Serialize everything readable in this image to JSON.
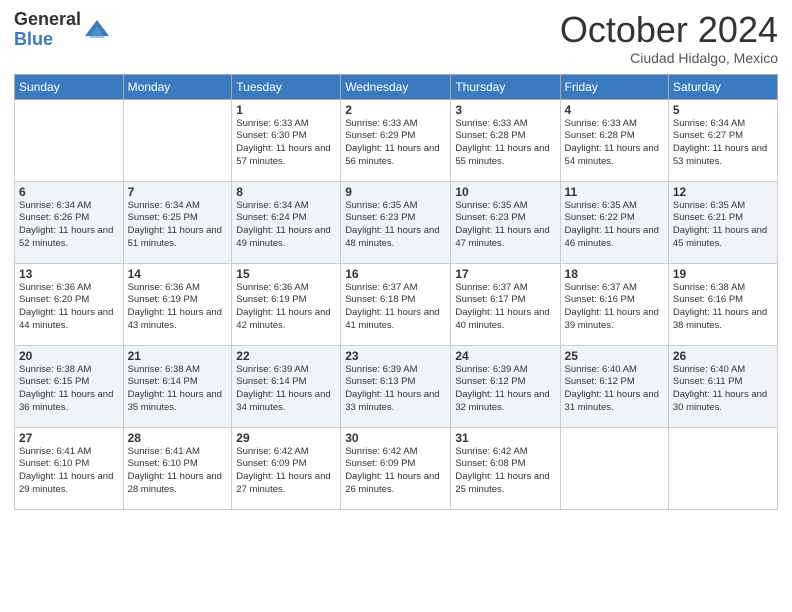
{
  "logo": {
    "general": "General",
    "blue": "Blue"
  },
  "title": "October 2024",
  "location": "Ciudad Hidalgo, Mexico",
  "days_of_week": [
    "Sunday",
    "Monday",
    "Tuesday",
    "Wednesday",
    "Thursday",
    "Friday",
    "Saturday"
  ],
  "weeks": [
    [
      {
        "day": "",
        "info": ""
      },
      {
        "day": "",
        "info": ""
      },
      {
        "day": "1",
        "info": "Sunrise: 6:33 AM\nSunset: 6:30 PM\nDaylight: 11 hours and 57 minutes."
      },
      {
        "day": "2",
        "info": "Sunrise: 6:33 AM\nSunset: 6:29 PM\nDaylight: 11 hours and 56 minutes."
      },
      {
        "day": "3",
        "info": "Sunrise: 6:33 AM\nSunset: 6:28 PM\nDaylight: 11 hours and 55 minutes."
      },
      {
        "day": "4",
        "info": "Sunrise: 6:33 AM\nSunset: 6:28 PM\nDaylight: 11 hours and 54 minutes."
      },
      {
        "day": "5",
        "info": "Sunrise: 6:34 AM\nSunset: 6:27 PM\nDaylight: 11 hours and 53 minutes."
      }
    ],
    [
      {
        "day": "6",
        "info": "Sunrise: 6:34 AM\nSunset: 6:26 PM\nDaylight: 11 hours and 52 minutes."
      },
      {
        "day": "7",
        "info": "Sunrise: 6:34 AM\nSunset: 6:25 PM\nDaylight: 11 hours and 51 minutes."
      },
      {
        "day": "8",
        "info": "Sunrise: 6:34 AM\nSunset: 6:24 PM\nDaylight: 11 hours and 49 minutes."
      },
      {
        "day": "9",
        "info": "Sunrise: 6:35 AM\nSunset: 6:23 PM\nDaylight: 11 hours and 48 minutes."
      },
      {
        "day": "10",
        "info": "Sunrise: 6:35 AM\nSunset: 6:23 PM\nDaylight: 11 hours and 47 minutes."
      },
      {
        "day": "11",
        "info": "Sunrise: 6:35 AM\nSunset: 6:22 PM\nDaylight: 11 hours and 46 minutes."
      },
      {
        "day": "12",
        "info": "Sunrise: 6:35 AM\nSunset: 6:21 PM\nDaylight: 11 hours and 45 minutes."
      }
    ],
    [
      {
        "day": "13",
        "info": "Sunrise: 6:36 AM\nSunset: 6:20 PM\nDaylight: 11 hours and 44 minutes."
      },
      {
        "day": "14",
        "info": "Sunrise: 6:36 AM\nSunset: 6:19 PM\nDaylight: 11 hours and 43 minutes."
      },
      {
        "day": "15",
        "info": "Sunrise: 6:36 AM\nSunset: 6:19 PM\nDaylight: 11 hours and 42 minutes."
      },
      {
        "day": "16",
        "info": "Sunrise: 6:37 AM\nSunset: 6:18 PM\nDaylight: 11 hours and 41 minutes."
      },
      {
        "day": "17",
        "info": "Sunrise: 6:37 AM\nSunset: 6:17 PM\nDaylight: 11 hours and 40 minutes."
      },
      {
        "day": "18",
        "info": "Sunrise: 6:37 AM\nSunset: 6:16 PM\nDaylight: 11 hours and 39 minutes."
      },
      {
        "day": "19",
        "info": "Sunrise: 6:38 AM\nSunset: 6:16 PM\nDaylight: 11 hours and 38 minutes."
      }
    ],
    [
      {
        "day": "20",
        "info": "Sunrise: 6:38 AM\nSunset: 6:15 PM\nDaylight: 11 hours and 36 minutes."
      },
      {
        "day": "21",
        "info": "Sunrise: 6:38 AM\nSunset: 6:14 PM\nDaylight: 11 hours and 35 minutes."
      },
      {
        "day": "22",
        "info": "Sunrise: 6:39 AM\nSunset: 6:14 PM\nDaylight: 11 hours and 34 minutes."
      },
      {
        "day": "23",
        "info": "Sunrise: 6:39 AM\nSunset: 6:13 PM\nDaylight: 11 hours and 33 minutes."
      },
      {
        "day": "24",
        "info": "Sunrise: 6:39 AM\nSunset: 6:12 PM\nDaylight: 11 hours and 32 minutes."
      },
      {
        "day": "25",
        "info": "Sunrise: 6:40 AM\nSunset: 6:12 PM\nDaylight: 11 hours and 31 minutes."
      },
      {
        "day": "26",
        "info": "Sunrise: 6:40 AM\nSunset: 6:11 PM\nDaylight: 11 hours and 30 minutes."
      }
    ],
    [
      {
        "day": "27",
        "info": "Sunrise: 6:41 AM\nSunset: 6:10 PM\nDaylight: 11 hours and 29 minutes."
      },
      {
        "day": "28",
        "info": "Sunrise: 6:41 AM\nSunset: 6:10 PM\nDaylight: 11 hours and 28 minutes."
      },
      {
        "day": "29",
        "info": "Sunrise: 6:42 AM\nSunset: 6:09 PM\nDaylight: 11 hours and 27 minutes."
      },
      {
        "day": "30",
        "info": "Sunrise: 6:42 AM\nSunset: 6:09 PM\nDaylight: 11 hours and 26 minutes."
      },
      {
        "day": "31",
        "info": "Sunrise: 6:42 AM\nSunset: 6:08 PM\nDaylight: 11 hours and 25 minutes."
      },
      {
        "day": "",
        "info": ""
      },
      {
        "day": "",
        "info": ""
      }
    ]
  ]
}
